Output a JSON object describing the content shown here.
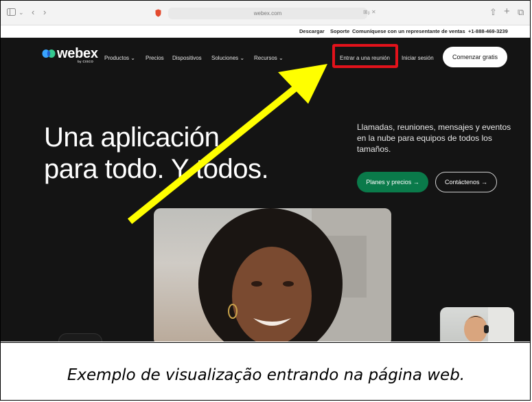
{
  "browser": {
    "url": "webex.com",
    "icons": [
      "sidebar-icon",
      "chevron-down-icon",
      "back-icon",
      "forward-icon",
      "shield-icon",
      "translate-icon",
      "close-icon",
      "share-icon",
      "new-tab-icon",
      "tabs-overview-icon"
    ]
  },
  "topbar": {
    "links": [
      "Descargar",
      "Soporte",
      "Comuníquese con un representante de ventas"
    ],
    "phone": "+1-888-469-3239"
  },
  "nav": {
    "brand": "webex",
    "brand_sub": "by CISCO",
    "items": [
      "Productos",
      "Precios",
      "Dispositivos",
      "Soluciones",
      "Recursos"
    ],
    "join_meeting": "Entrar a una reunión",
    "sign_in": "Iniciar sesión",
    "start_free": "Comenzar gratis"
  },
  "hero": {
    "headline_line1": "Una aplicación",
    "headline_line2": "para todo. Y todos.",
    "subtext": "Llamadas, reuniones, mensajes y eventos en la nube para equipos de todos los tamaños.",
    "primary_button": "Planes y precios →",
    "secondary_button": "Contáctenos →"
  },
  "annotation": {
    "highlight_color": "#e3121b",
    "arrow_color": "#ffff00"
  },
  "caption": "Exemplo de visualização entrando na página web."
}
